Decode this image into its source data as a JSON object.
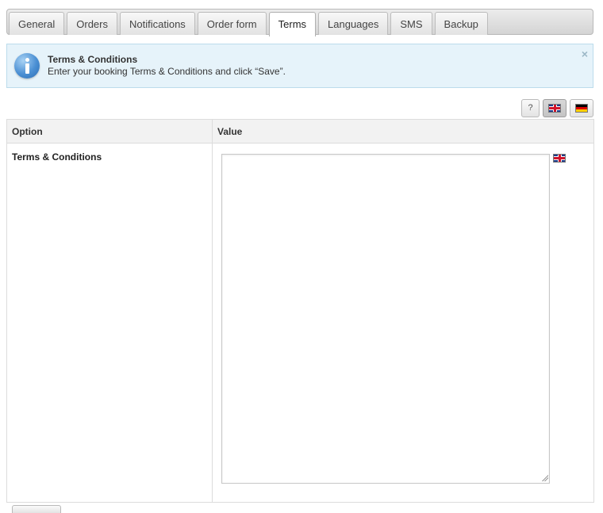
{
  "tabs": [
    {
      "label": "General",
      "active": false
    },
    {
      "label": "Orders",
      "active": false
    },
    {
      "label": "Notifications",
      "active": false
    },
    {
      "label": "Order form",
      "active": false
    },
    {
      "label": "Terms",
      "active": true
    },
    {
      "label": "Languages",
      "active": false
    },
    {
      "label": "SMS",
      "active": false
    },
    {
      "label": "Backup",
      "active": false
    }
  ],
  "notice": {
    "icon": "info-icon",
    "title": "Terms & Conditions",
    "text": "Enter your booking Terms & Conditions and click “Save”.",
    "close_label": "×"
  },
  "toolbar": {
    "help_label": "?",
    "languages": [
      {
        "icon": "uk-flag-icon",
        "selected": true
      },
      {
        "icon": "germany-flag-icon",
        "selected": false
      }
    ]
  },
  "table": {
    "headers": {
      "option": "Option",
      "value": "Value"
    },
    "rows": [
      {
        "option": "Terms & Conditions",
        "value": "",
        "language_icon": "uk-flag-icon"
      }
    ]
  },
  "colors": {
    "notice_bg": "#e6f3fa",
    "notice_border": "#bcdcec",
    "info_blue": "#4a8fd3"
  }
}
